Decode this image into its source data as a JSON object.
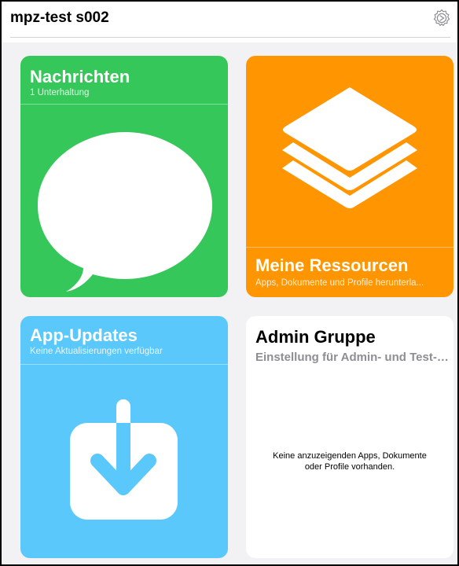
{
  "header": {
    "title": "mpz-test s002",
    "settings_icon": "gear-icon"
  },
  "tiles": {
    "messages": {
      "title": "Nachrichten",
      "subtitle": "1 Unterhaltung",
      "color": "#35c759",
      "icon": "speech-bubble-icon"
    },
    "resources": {
      "title": "Meine Ressourcen",
      "subtitle": "Apps, Dokumente und Profile herunterla...",
      "color": "#ff9500",
      "icon": "layers-icon"
    },
    "updates": {
      "title": "App-Updates",
      "subtitle": "Keine Aktualisierungen verfügbar",
      "color": "#5ac8fa",
      "icon": "download-icon"
    },
    "admin": {
      "title": "Admin Gruppe",
      "subtitle": "Einstellung für Admin- und Test-A...",
      "empty_line1": "Keine anzuzeigenden Apps, Dokumente",
      "empty_line2": "oder Profile vorhanden."
    }
  }
}
